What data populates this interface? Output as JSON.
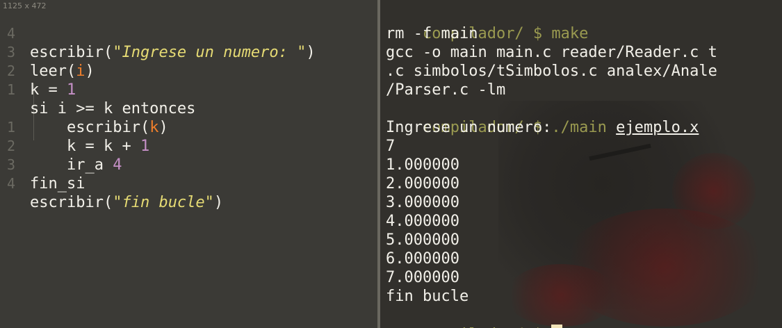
{
  "window": {
    "size_label": "1125 x 472"
  },
  "editor": {
    "lines": [
      {
        "num": "4",
        "parts": [
          "escribir(",
          "\"Ingrese un numero: \"",
          ")"
        ]
      },
      {
        "num": "3",
        "parts": [
          "leer(",
          "i",
          ")"
        ]
      },
      {
        "num": "2",
        "parts": [
          "k = ",
          "1"
        ]
      },
      {
        "num": "1",
        "parts": [
          "si i >= k entonces"
        ]
      },
      {
        "num": "",
        "parts": [
          "    escribir(",
          "k",
          ")"
        ]
      },
      {
        "num": "1",
        "parts": [
          "    k = k + ",
          "1"
        ]
      },
      {
        "num": "2",
        "parts": [
          "    ir_a ",
          "4"
        ]
      },
      {
        "num": "3",
        "parts": [
          "fin_si"
        ]
      },
      {
        "num": "4",
        "parts": [
          "escribir(",
          "\"fin bucle\"",
          ")"
        ]
      }
    ]
  },
  "terminal": {
    "prompt": "compilador/ $ ",
    "cmd1": "make",
    "out_rm": "rm -f main",
    "out_gcc1": "gcc -o main main.c reader/Reader.c t",
    "out_gcc2": ".c simbolos/tSimbolos.c analex/Anale",
    "out_gcc3": "/Parser.c -lm",
    "cmd2_prog": "./main ",
    "cmd2_arg": "ejemplo.x",
    "out_ask": "Ingrese un numero:",
    "out_input": "7",
    "out_values": [
      "1.000000",
      "2.000000",
      "3.000000",
      "4.000000",
      "5.000000",
      "6.000000",
      "7.000000"
    ],
    "out_end": "fin bucle"
  }
}
